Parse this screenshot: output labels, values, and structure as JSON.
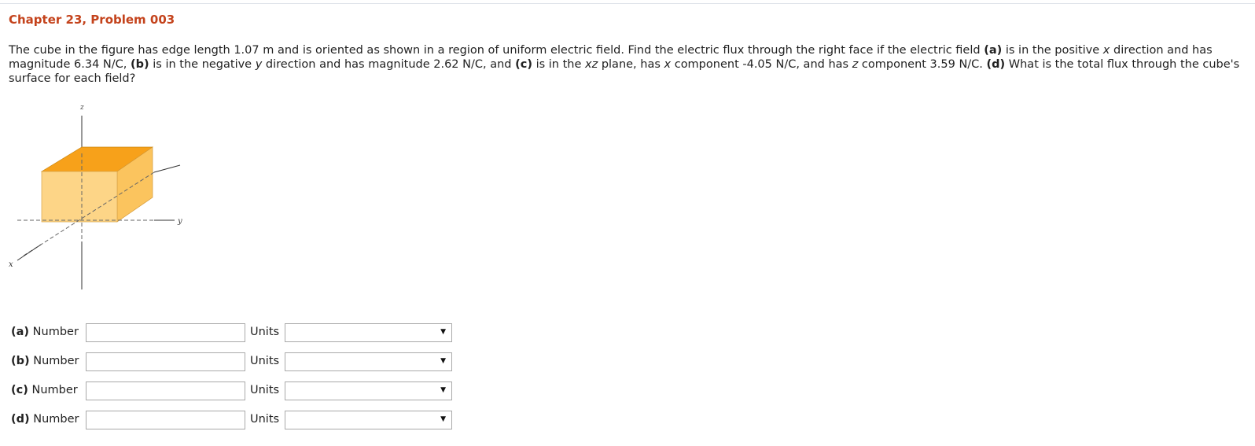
{
  "page": {
    "title": "Chapter 23, Problem 003"
  },
  "problem": {
    "s1": "The cube in the figure has edge length 1.07 m and is oriented as shown in a region of uniform electric field. Find the electric flux through the right face if the electric field ",
    "a_tag": "(a)",
    "s2": " is in the positive ",
    "x1": "x",
    "s3": " direction and has magnitude 6.34 N/C, ",
    "b_tag": "(b)",
    "s4": " is in the negative ",
    "y1": "y",
    "s5": " direction and has magnitude 2.62 N/C, and ",
    "c_tag": "(c)",
    "s6": " is in the ",
    "xz": "xz",
    "s7": " plane, has ",
    "x2": "x",
    "s8": " component -4.05 N/C, and has ",
    "z1": "z",
    "s9": " component 3.59 N/C. ",
    "d_tag": "(d)",
    "s10": " What is the total flux through the cube's surface for each field?"
  },
  "figure": {
    "axis_z": "z",
    "axis_y": "y",
    "axis_x": "x",
    "colors": {
      "top": "#f7a11a",
      "front": "#fdd587",
      "side": "#fbc45e"
    }
  },
  "answers": [
    {
      "tag": "(a)",
      "label": " Number",
      "value": "",
      "units_label": "Units",
      "units_value": "",
      "arrow": "▼"
    },
    {
      "tag": "(b)",
      "label": " Number",
      "value": "",
      "units_label": "Units",
      "units_value": "",
      "arrow": "▼"
    },
    {
      "tag": "(c)",
      "label": " Number",
      "value": "",
      "units_label": "Units",
      "units_value": "",
      "arrow": "▼"
    },
    {
      "tag": "(d)",
      "label": " Number",
      "value": "",
      "units_label": "Units",
      "units_value": "",
      "arrow": "▼"
    }
  ]
}
